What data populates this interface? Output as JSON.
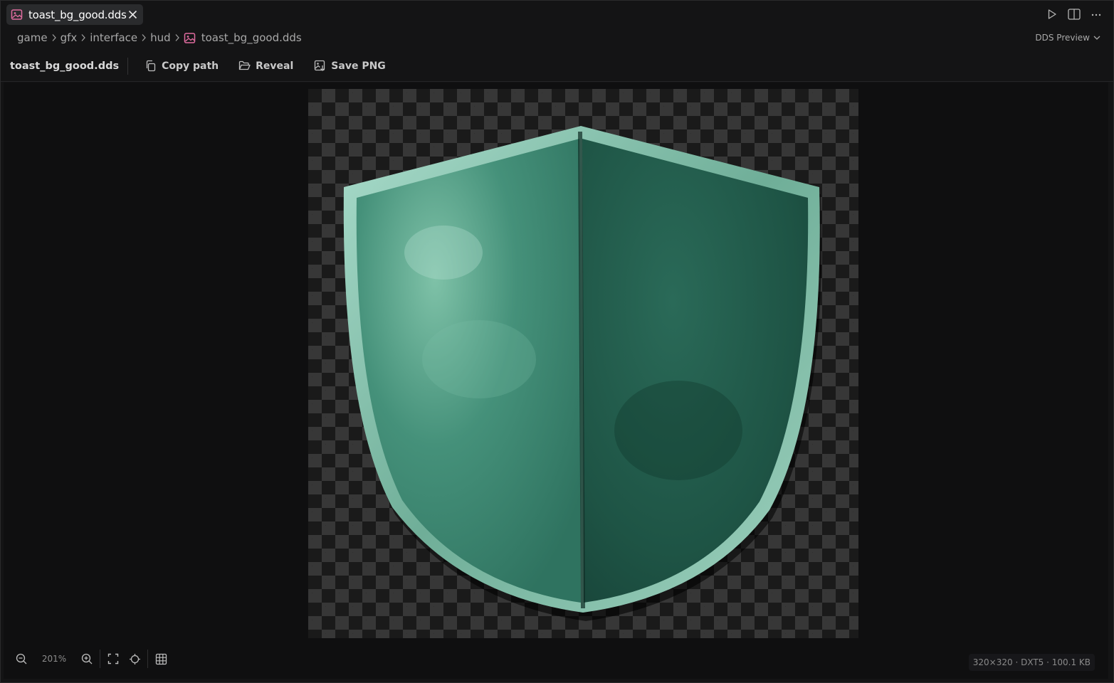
{
  "tab": {
    "label": "toast_bg_good.dds",
    "icon": "image-file-icon",
    "accent": "#e06c9f"
  },
  "top_actions": [
    "run-icon",
    "split-editor-icon",
    "more-icon"
  ],
  "breadcrumb": {
    "items": [
      "game",
      "gfx",
      "interface",
      "hud",
      "toast_bg_good.dds"
    ]
  },
  "preview_mode": {
    "label": "DDS Preview"
  },
  "toolbar": {
    "file_title": "toast_bg_good.dds",
    "copy_path_label": "Copy path",
    "reveal_label": "Reveal",
    "save_png_label": "Save PNG"
  },
  "zoom": {
    "level": "201%"
  },
  "status": {
    "info": "320×320 · DXT5 · 100.1 KB"
  },
  "image": {
    "subject": "shield-texture",
    "colors": {
      "left_half": "#3f8a70",
      "right_half": "#1f5647",
      "rim": "#8fc9b3"
    }
  }
}
